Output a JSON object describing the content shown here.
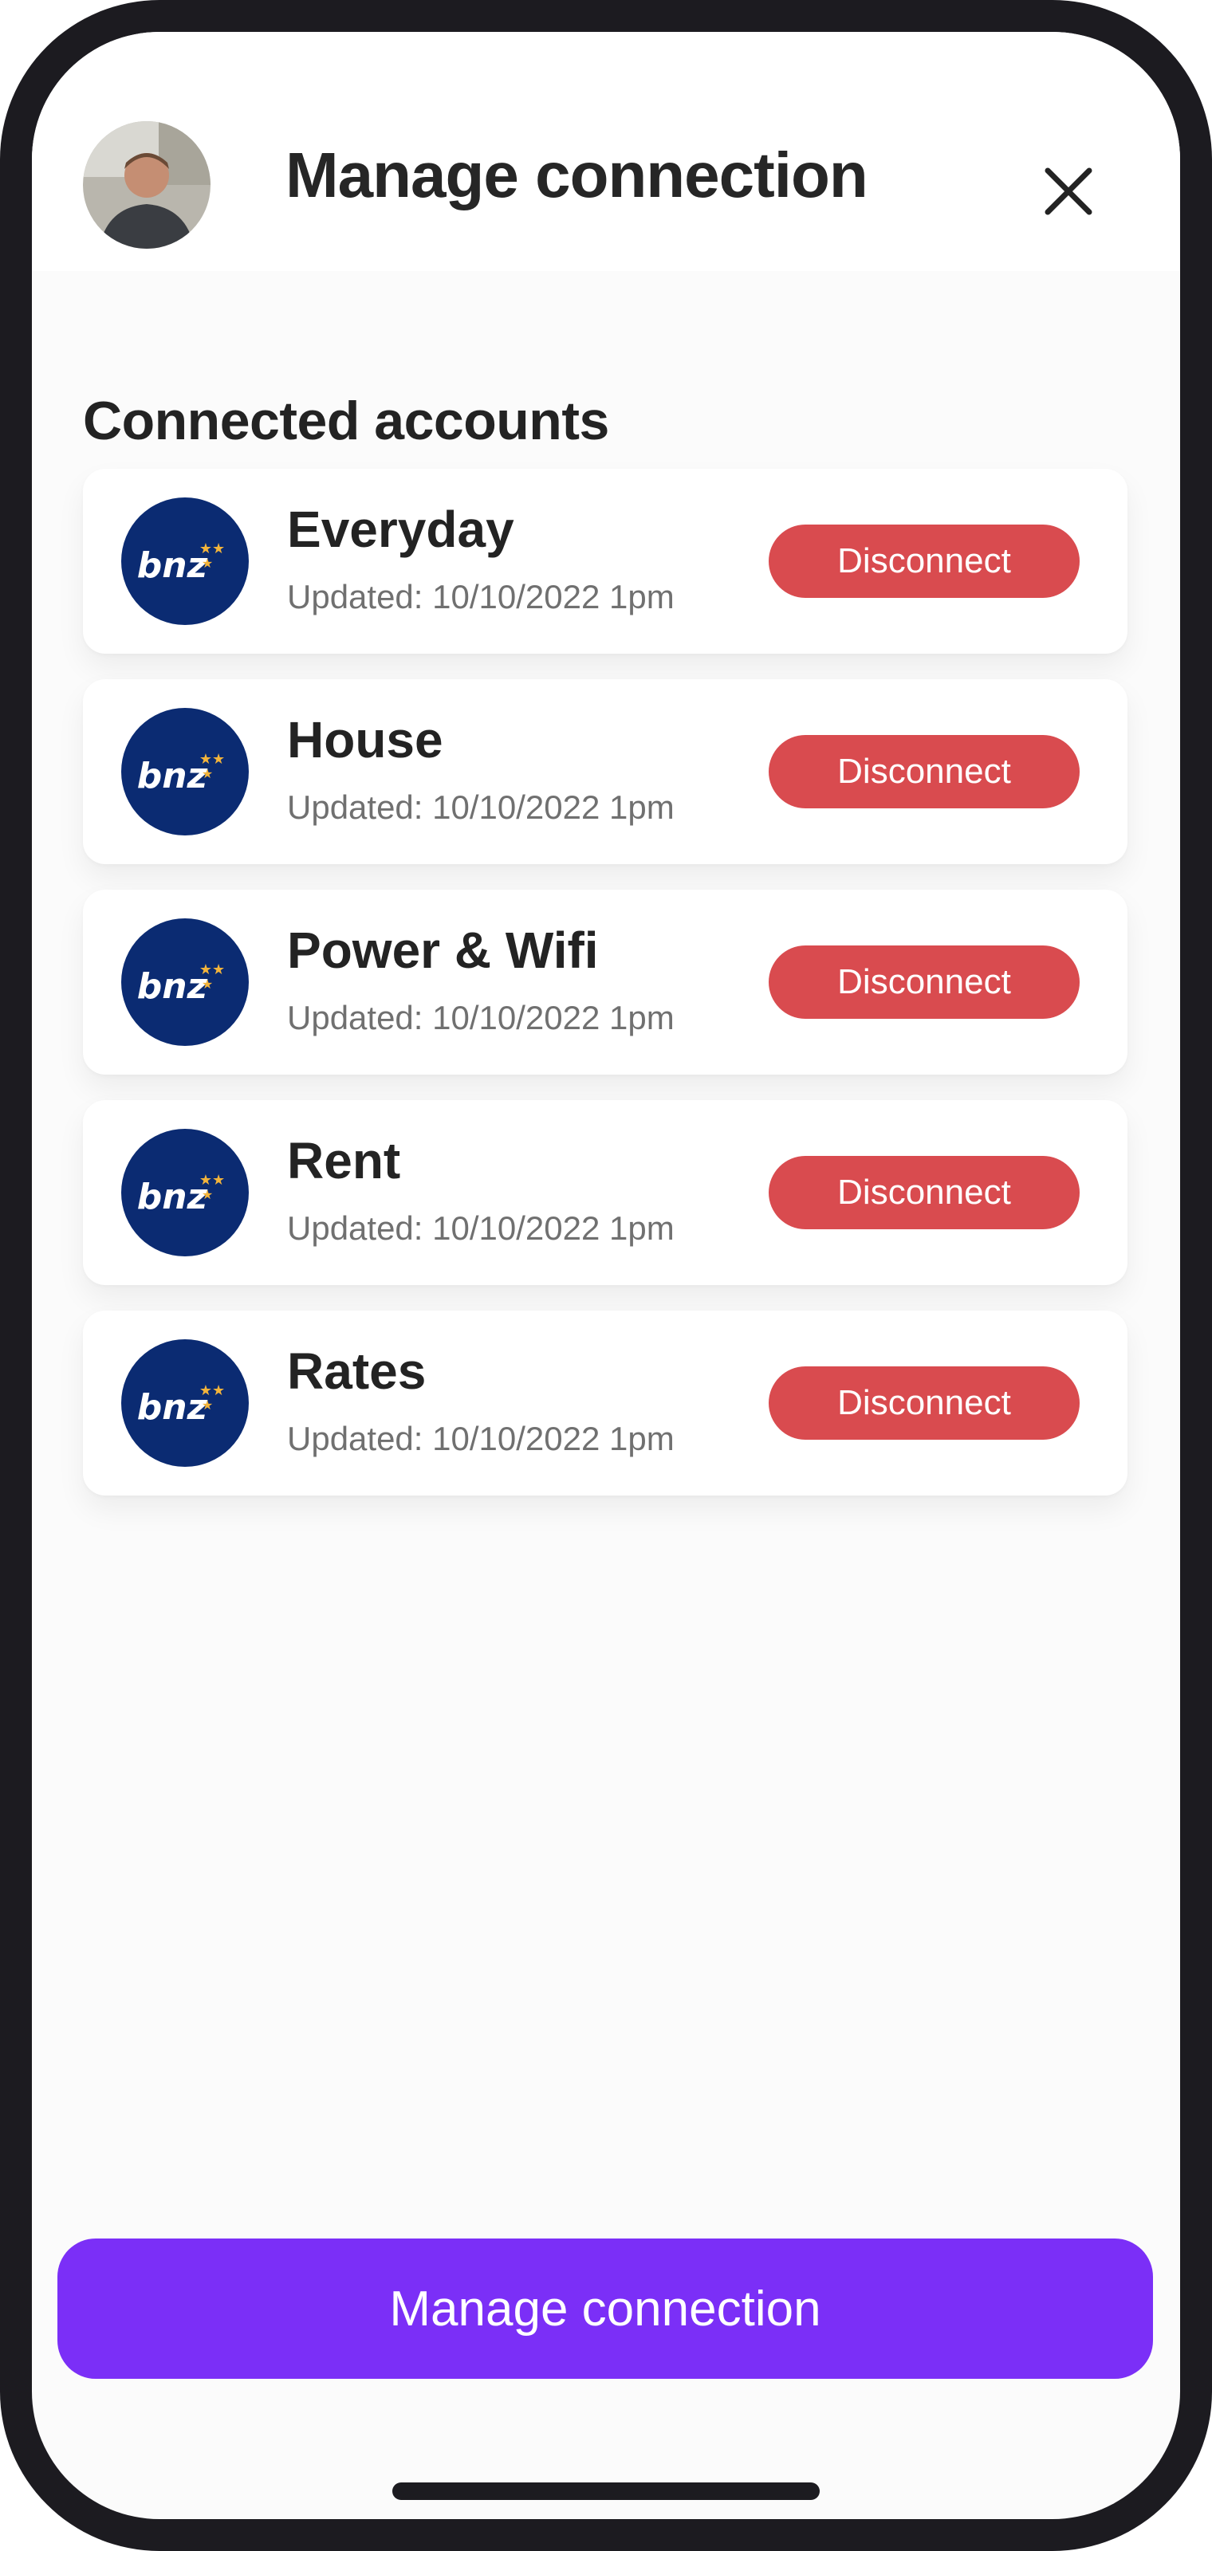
{
  "header": {
    "title": "Manage connection",
    "avatar_icon": "user-avatar-photo",
    "close_icon": "close-icon"
  },
  "section": {
    "title": "Connected accounts"
  },
  "accounts": [
    {
      "name": "Everyday",
      "updated": "Updated: 10/10/2022 1pm",
      "action": "Disconnect",
      "bank_logo_text": "bnz"
    },
    {
      "name": "House",
      "updated": "Updated: 10/10/2022 1pm",
      "action": "Disconnect",
      "bank_logo_text": "bnz"
    },
    {
      "name": "Power & Wifi",
      "updated": "Updated: 10/10/2022 1pm",
      "action": "Disconnect",
      "bank_logo_text": "bnz"
    },
    {
      "name": "Rent",
      "updated": "Updated: 10/10/2022 1pm",
      "action": "Disconnect",
      "bank_logo_text": "bnz"
    },
    {
      "name": "Rates",
      "updated": "Updated: 10/10/2022 1pm",
      "action": "Disconnect",
      "bank_logo_text": "bnz"
    }
  ],
  "footer": {
    "primary_button_label": "Manage connection"
  },
  "colors": {
    "primary": "#7b2ff7",
    "danger": "#d94b4f",
    "bank_blue": "#0b2b72",
    "bank_star": "#f3b43b",
    "background": "#fbfbfb",
    "text": "#232323",
    "muted_text": "#707070"
  }
}
